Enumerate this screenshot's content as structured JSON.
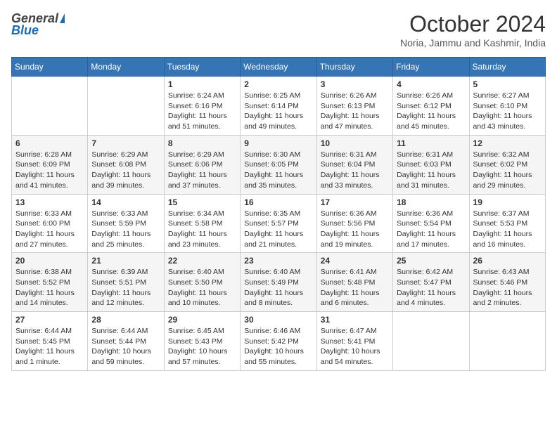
{
  "header": {
    "logo_general": "General",
    "logo_blue": "Blue",
    "month_title": "October 2024",
    "location": "Noria, Jammu and Kashmir, India"
  },
  "days_of_week": [
    "Sunday",
    "Monday",
    "Tuesday",
    "Wednesday",
    "Thursday",
    "Friday",
    "Saturday"
  ],
  "weeks": [
    [
      {
        "day": "",
        "sunrise": "",
        "sunset": "",
        "daylight": ""
      },
      {
        "day": "",
        "sunrise": "",
        "sunset": "",
        "daylight": ""
      },
      {
        "day": "1",
        "sunrise": "Sunrise: 6:24 AM",
        "sunset": "Sunset: 6:16 PM",
        "daylight": "Daylight: 11 hours and 51 minutes."
      },
      {
        "day": "2",
        "sunrise": "Sunrise: 6:25 AM",
        "sunset": "Sunset: 6:14 PM",
        "daylight": "Daylight: 11 hours and 49 minutes."
      },
      {
        "day": "3",
        "sunrise": "Sunrise: 6:26 AM",
        "sunset": "Sunset: 6:13 PM",
        "daylight": "Daylight: 11 hours and 47 minutes."
      },
      {
        "day": "4",
        "sunrise": "Sunrise: 6:26 AM",
        "sunset": "Sunset: 6:12 PM",
        "daylight": "Daylight: 11 hours and 45 minutes."
      },
      {
        "day": "5",
        "sunrise": "Sunrise: 6:27 AM",
        "sunset": "Sunset: 6:10 PM",
        "daylight": "Daylight: 11 hours and 43 minutes."
      }
    ],
    [
      {
        "day": "6",
        "sunrise": "Sunrise: 6:28 AM",
        "sunset": "Sunset: 6:09 PM",
        "daylight": "Daylight: 11 hours and 41 minutes."
      },
      {
        "day": "7",
        "sunrise": "Sunrise: 6:29 AM",
        "sunset": "Sunset: 6:08 PM",
        "daylight": "Daylight: 11 hours and 39 minutes."
      },
      {
        "day": "8",
        "sunrise": "Sunrise: 6:29 AM",
        "sunset": "Sunset: 6:06 PM",
        "daylight": "Daylight: 11 hours and 37 minutes."
      },
      {
        "day": "9",
        "sunrise": "Sunrise: 6:30 AM",
        "sunset": "Sunset: 6:05 PM",
        "daylight": "Daylight: 11 hours and 35 minutes."
      },
      {
        "day": "10",
        "sunrise": "Sunrise: 6:31 AM",
        "sunset": "Sunset: 6:04 PM",
        "daylight": "Daylight: 11 hours and 33 minutes."
      },
      {
        "day": "11",
        "sunrise": "Sunrise: 6:31 AM",
        "sunset": "Sunset: 6:03 PM",
        "daylight": "Daylight: 11 hours and 31 minutes."
      },
      {
        "day": "12",
        "sunrise": "Sunrise: 6:32 AM",
        "sunset": "Sunset: 6:02 PM",
        "daylight": "Daylight: 11 hours and 29 minutes."
      }
    ],
    [
      {
        "day": "13",
        "sunrise": "Sunrise: 6:33 AM",
        "sunset": "Sunset: 6:00 PM",
        "daylight": "Daylight: 11 hours and 27 minutes."
      },
      {
        "day": "14",
        "sunrise": "Sunrise: 6:33 AM",
        "sunset": "Sunset: 5:59 PM",
        "daylight": "Daylight: 11 hours and 25 minutes."
      },
      {
        "day": "15",
        "sunrise": "Sunrise: 6:34 AM",
        "sunset": "Sunset: 5:58 PM",
        "daylight": "Daylight: 11 hours and 23 minutes."
      },
      {
        "day": "16",
        "sunrise": "Sunrise: 6:35 AM",
        "sunset": "Sunset: 5:57 PM",
        "daylight": "Daylight: 11 hours and 21 minutes."
      },
      {
        "day": "17",
        "sunrise": "Sunrise: 6:36 AM",
        "sunset": "Sunset: 5:56 PM",
        "daylight": "Daylight: 11 hours and 19 minutes."
      },
      {
        "day": "18",
        "sunrise": "Sunrise: 6:36 AM",
        "sunset": "Sunset: 5:54 PM",
        "daylight": "Daylight: 11 hours and 17 minutes."
      },
      {
        "day": "19",
        "sunrise": "Sunrise: 6:37 AM",
        "sunset": "Sunset: 5:53 PM",
        "daylight": "Daylight: 11 hours and 16 minutes."
      }
    ],
    [
      {
        "day": "20",
        "sunrise": "Sunrise: 6:38 AM",
        "sunset": "Sunset: 5:52 PM",
        "daylight": "Daylight: 11 hours and 14 minutes."
      },
      {
        "day": "21",
        "sunrise": "Sunrise: 6:39 AM",
        "sunset": "Sunset: 5:51 PM",
        "daylight": "Daylight: 11 hours and 12 minutes."
      },
      {
        "day": "22",
        "sunrise": "Sunrise: 6:40 AM",
        "sunset": "Sunset: 5:50 PM",
        "daylight": "Daylight: 11 hours and 10 minutes."
      },
      {
        "day": "23",
        "sunrise": "Sunrise: 6:40 AM",
        "sunset": "Sunset: 5:49 PM",
        "daylight": "Daylight: 11 hours and 8 minutes."
      },
      {
        "day": "24",
        "sunrise": "Sunrise: 6:41 AM",
        "sunset": "Sunset: 5:48 PM",
        "daylight": "Daylight: 11 hours and 6 minutes."
      },
      {
        "day": "25",
        "sunrise": "Sunrise: 6:42 AM",
        "sunset": "Sunset: 5:47 PM",
        "daylight": "Daylight: 11 hours and 4 minutes."
      },
      {
        "day": "26",
        "sunrise": "Sunrise: 6:43 AM",
        "sunset": "Sunset: 5:46 PM",
        "daylight": "Daylight: 11 hours and 2 minutes."
      }
    ],
    [
      {
        "day": "27",
        "sunrise": "Sunrise: 6:44 AM",
        "sunset": "Sunset: 5:45 PM",
        "daylight": "Daylight: 11 hours and 1 minute."
      },
      {
        "day": "28",
        "sunrise": "Sunrise: 6:44 AM",
        "sunset": "Sunset: 5:44 PM",
        "daylight": "Daylight: 10 hours and 59 minutes."
      },
      {
        "day": "29",
        "sunrise": "Sunrise: 6:45 AM",
        "sunset": "Sunset: 5:43 PM",
        "daylight": "Daylight: 10 hours and 57 minutes."
      },
      {
        "day": "30",
        "sunrise": "Sunrise: 6:46 AM",
        "sunset": "Sunset: 5:42 PM",
        "daylight": "Daylight: 10 hours and 55 minutes."
      },
      {
        "day": "31",
        "sunrise": "Sunrise: 6:47 AM",
        "sunset": "Sunset: 5:41 PM",
        "daylight": "Daylight: 10 hours and 54 minutes."
      },
      {
        "day": "",
        "sunrise": "",
        "sunset": "",
        "daylight": ""
      },
      {
        "day": "",
        "sunrise": "",
        "sunset": "",
        "daylight": ""
      }
    ]
  ]
}
